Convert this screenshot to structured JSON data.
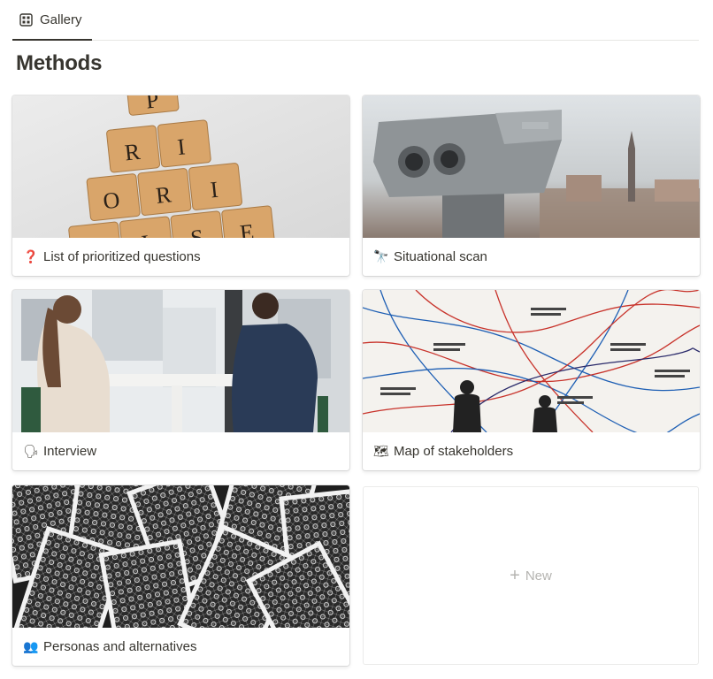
{
  "tabs": [
    {
      "label": "Gallery",
      "icon": "gallery-grid-icon",
      "active": true
    }
  ],
  "page": {
    "title": "Methods"
  },
  "cards": [
    {
      "title": "List of prioritized questions",
      "emoji": "❓",
      "cover": "scrabble-tiles-prioritise"
    },
    {
      "title": "Situational scan",
      "emoji": "🔭",
      "cover": "coin-binoculars-city"
    },
    {
      "title": "Interview",
      "emoji": "🗣",
      "cover": "two-women-talking-at-table"
    },
    {
      "title": "Map of stakeholders",
      "emoji": "🗺",
      "cover": "wall-diagram-arrows"
    },
    {
      "title": "Personas and alternatives",
      "emoji": "👥",
      "cover": "scattered-playing-cards"
    }
  ],
  "new_button": {
    "label": "New",
    "icon": "plus-icon"
  },
  "cover_tiles": [
    "P",
    "R",
    "I",
    "O",
    "R",
    "I",
    "T",
    "I",
    "S",
    "E"
  ]
}
